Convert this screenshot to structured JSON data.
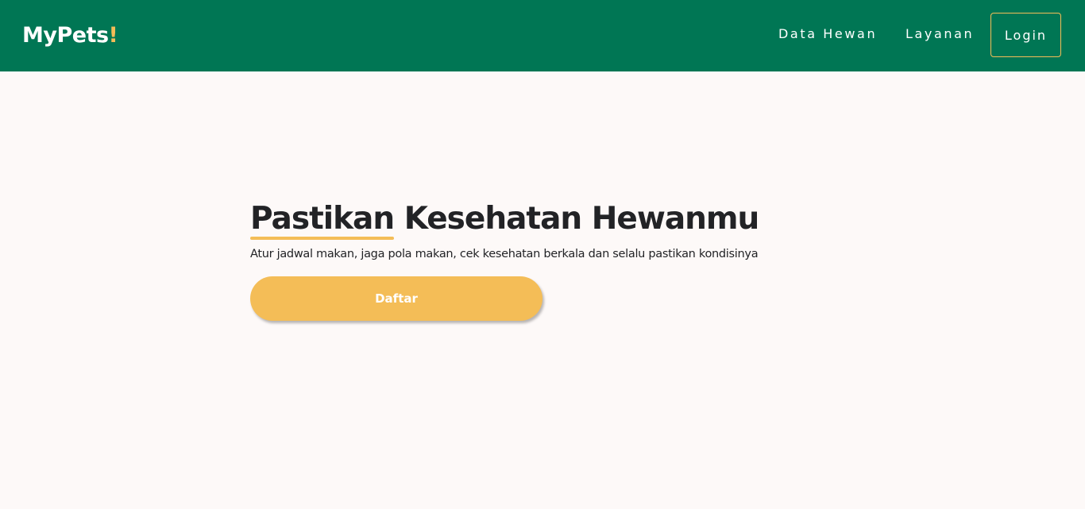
{
  "navbar": {
    "brand_text": "MyPets",
    "brand_mark": "!",
    "links": [
      {
        "label": "Data Hewan"
      },
      {
        "label": "Layanan"
      }
    ],
    "login_label": "Login"
  },
  "hero": {
    "headline_first": "Pastikan",
    "headline_rest": "Kesehatan Hewanmu",
    "subtitle": "Atur jadwal makan, jaga pola makan, cek kesehatan berkala dan selalu pastikan kondisinya",
    "cta_label": "Daftar"
  },
  "colors": {
    "navbar_bg": "#007654",
    "accent": "#f4bd57",
    "page_bg": "#fdf9f8",
    "text_dark": "#222326"
  }
}
